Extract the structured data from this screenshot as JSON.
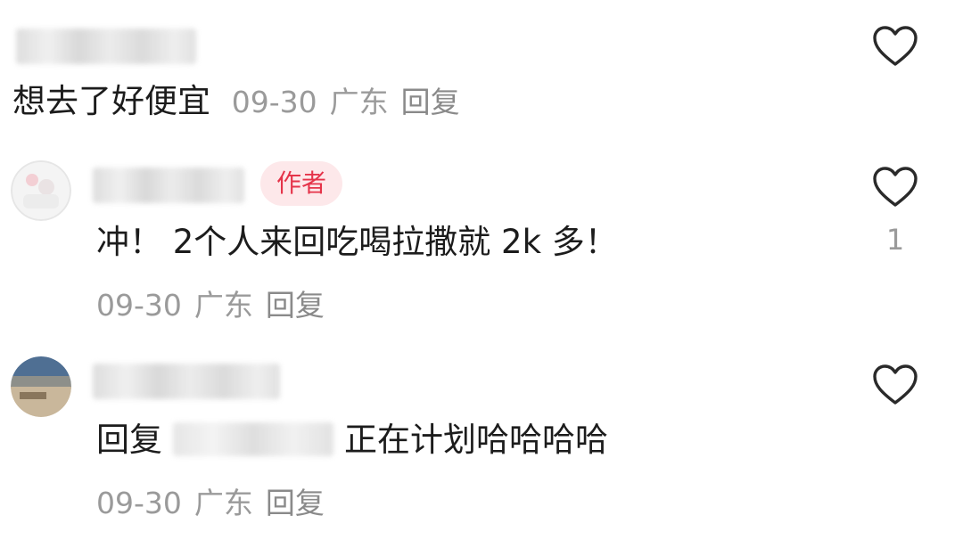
{
  "comments": [
    {
      "text": "想去了好便宜",
      "date": "09-30",
      "location": "广东",
      "reply_label": "回复",
      "like_count": ""
    },
    {
      "author_badge": "作者",
      "text": "冲！ 2个人来回吃喝拉撒就 2k 多！",
      "date": "09-30",
      "location": "广东",
      "reply_label": "回复",
      "like_count": "1"
    },
    {
      "reply_prefix": "回复",
      "text": "正在计划哈哈哈哈",
      "date": "09-30",
      "location": "广东",
      "reply_label": "回复",
      "like_count": ""
    }
  ],
  "icons": {
    "like": "heart-outline-icon"
  },
  "colors": {
    "author_badge_bg": "#fde8ea",
    "author_badge_text": "#e5344a",
    "meta_text": "#9a9a9a",
    "heart_stroke": "#2a2a2a"
  }
}
